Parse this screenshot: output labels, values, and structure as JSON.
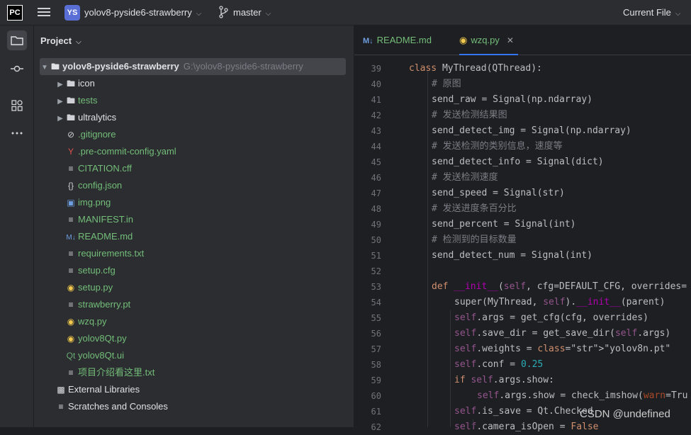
{
  "topbar": {
    "logo": "PC",
    "project_badge": "YS",
    "project_name": "yolov8-pyside6-strawberry",
    "branch": "master",
    "run_config": "Current File"
  },
  "project_panel": {
    "title": "Project",
    "root": {
      "name": "yolov8-pyside6-strawberry",
      "path": "G:\\yolov8-pyside6-strawberry"
    },
    "items": [
      {
        "name": "icon",
        "kind": "folder",
        "color": "white"
      },
      {
        "name": "tests",
        "kind": "folder",
        "color": "green"
      },
      {
        "name": "ultralytics",
        "kind": "package",
        "color": "white"
      },
      {
        "name": ".gitignore",
        "kind": "gitignore",
        "color": "green"
      },
      {
        "name": ".pre-commit-config.yaml",
        "kind": "yaml",
        "color": "green"
      },
      {
        "name": "CITATION.cff",
        "kind": "text",
        "color": "green"
      },
      {
        "name": "config.json",
        "kind": "json",
        "color": "green"
      },
      {
        "name": "img.png",
        "kind": "image",
        "color": "green"
      },
      {
        "name": "MANIFEST.in",
        "kind": "text",
        "color": "green"
      },
      {
        "name": "README.md",
        "kind": "markdown",
        "color": "green"
      },
      {
        "name": "requirements.txt",
        "kind": "text",
        "color": "green"
      },
      {
        "name": "setup.cfg",
        "kind": "text",
        "color": "green"
      },
      {
        "name": "setup.py",
        "kind": "python",
        "color": "green"
      },
      {
        "name": "strawberry.pt",
        "kind": "text",
        "color": "green"
      },
      {
        "name": "wzq.py",
        "kind": "python",
        "color": "green"
      },
      {
        "name": "yolov8Qt.py",
        "kind": "python",
        "color": "green"
      },
      {
        "name": "yolov8Qt.ui",
        "kind": "qt-ui",
        "color": "green"
      },
      {
        "name": "项目介绍看这里.txt",
        "kind": "text",
        "color": "green"
      }
    ],
    "external_libraries": "External Libraries",
    "scratches": "Scratches and Consoles"
  },
  "editor": {
    "tabs": [
      {
        "label": "README.md",
        "icon": "markdown-icon",
        "active": false
      },
      {
        "label": "wzq.py",
        "icon": "python-icon",
        "active": true
      }
    ],
    "code_lines": [
      {
        "n": "39",
        "text": "class MyThread(QThread):"
      },
      {
        "n": "40",
        "text": "# 原图"
      },
      {
        "n": "41",
        "text": "send_raw = Signal(np.ndarray)"
      },
      {
        "n": "42",
        "text": "# 发送检测结果图"
      },
      {
        "n": "43",
        "text": "send_detect_img = Signal(np.ndarray)"
      },
      {
        "n": "44",
        "text": "# 发送检测的类别信息，速度等"
      },
      {
        "n": "45",
        "text": "send_detect_info = Signal(dict)"
      },
      {
        "n": "46",
        "text": "# 发送检测速度"
      },
      {
        "n": "47",
        "text": "send_speed = Signal(str)"
      },
      {
        "n": "48",
        "text": "# 发送进度条百分比"
      },
      {
        "n": "49",
        "text": "send_percent = Signal(int)"
      },
      {
        "n": "50",
        "text": "# 检测到的目标数量"
      },
      {
        "n": "51",
        "text": "send_detect_num = Signal(int)"
      },
      {
        "n": "52",
        "text": ""
      },
      {
        "n": "53",
        "text": "def __init__(self, cfg=DEFAULT_CFG, overrides="
      },
      {
        "n": "54",
        "text": "super(MyThread, self).__init__(parent)"
      },
      {
        "n": "55",
        "text": "self.args = get_cfg(cfg, overrides)"
      },
      {
        "n": "56",
        "text": "self.save_dir = get_save_dir(self.args)"
      },
      {
        "n": "57",
        "text": "self.weights = \"yolov8n.pt\""
      },
      {
        "n": "58",
        "text": "self.conf = 0.25"
      },
      {
        "n": "59",
        "text": "if self.args.show:"
      },
      {
        "n": "60",
        "text": "self.args.show = check_imshow(warn=Tru"
      },
      {
        "n": "61",
        "text": "self.is_save = Qt.Checked"
      },
      {
        "n": "62",
        "text": "self.camera_isOpen = False"
      }
    ]
  },
  "watermark": "CSDN @undefined"
}
